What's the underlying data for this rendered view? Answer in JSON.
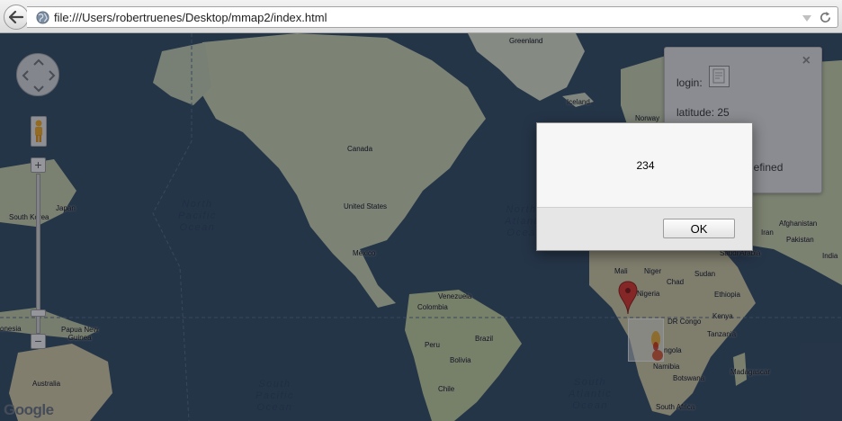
{
  "browser": {
    "url": "file:///Users/robertruenes/Desktop/mmap2/index.html"
  },
  "map": {
    "country_labels": {
      "greenland": "Greenland",
      "iceland": "Iceland",
      "norway": "Norway",
      "canada": "Canada",
      "united_states": "United States",
      "mexico": "Mexico",
      "venezuela": "Venezuela",
      "colombia": "Colombia",
      "peru": "Peru",
      "brazil": "Brazil",
      "bolivia": "Bolivia",
      "chile": "Chile",
      "south_korea": "South Korea",
      "japan": "Japan",
      "indonesia": "onesia",
      "papua_new_guinea": "Papua New\nGuinea",
      "australia": "Australia",
      "mali": "Mali",
      "niger": "Niger",
      "chad": "Chad",
      "sudan": "Sudan",
      "nigeria": "Nigeria",
      "ethiopia": "Ethiopia",
      "dr_congo": "DR Congo",
      "kenya": "Kenya",
      "tanzania": "Tanzania",
      "angola": "ngola",
      "namibia": "Namibia",
      "botswana": "Botswana",
      "madagascar": "Madagascar",
      "south_africa": "South Africa",
      "saudi_arabia": "Saudi Arabia",
      "afghanistan": "Afghanistan",
      "iran": "Iran",
      "pakistan": "Pakistan",
      "india": "India"
    },
    "ocean_labels": {
      "north_pacific": "North\nPacific\nOcean",
      "north_atlantic": "North\nAtlant\nOcea",
      "south_pacific": "South\nPacific\nOcean",
      "south_atlantic": "South\nAtlantic\nOcean"
    },
    "attribution": "Google"
  },
  "info_window": {
    "login_label": "login:",
    "latitude_text": "latitude: 25",
    "hidden_text": "defined"
  },
  "alert": {
    "message": "234",
    "ok_label": "OK"
  }
}
